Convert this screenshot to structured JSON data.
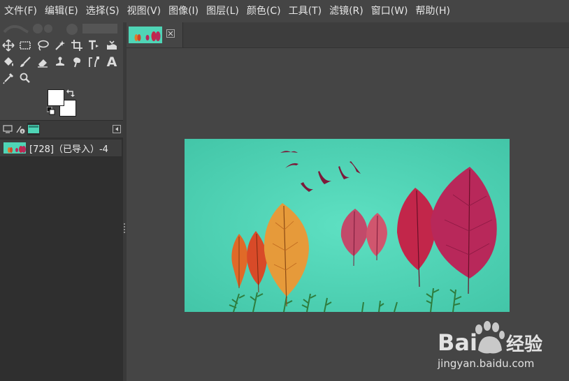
{
  "menubar": {
    "items": [
      "文件(F)",
      "编辑(E)",
      "选择(S)",
      "视图(V)",
      "图像(I)",
      "图层(L)",
      "颜色(C)",
      "工具(T)",
      "滤镜(R)",
      "窗口(W)",
      "帮助(H)"
    ]
  },
  "toolbox": {
    "tools": [
      "move-tool",
      "rect-select-tool",
      "lasso-select-tool",
      "fuzzy-select-tool",
      "crop-tool",
      "unified-transform-tool",
      "warp-transform-tool",
      "bucket-fill-tool",
      "paintbrush-tool",
      "eraser-tool",
      "clone-tool",
      "smudge-tool",
      "paths-tool",
      "text-tool",
      "color-picker-tool",
      "zoom-tool"
    ],
    "text_tool_glyph": "A",
    "foreground_color": "#ffffff",
    "background_color": "#ffffff"
  },
  "layers": {
    "rows": [
      {
        "name": "[728]（已导入）-4"
      }
    ]
  },
  "image_tab": {
    "close_icon": "close-icon"
  },
  "canvas": {
    "background_color": "#4fd5b6",
    "description_colors": {
      "teal": "#4fd5b6",
      "orange_leaf": "#e07a2a",
      "red_leaf": "#c2264a",
      "magenta_leaf": "#b8285a",
      "grass": "#2e7d3e"
    }
  },
  "watermark": {
    "brand": "Bai",
    "brand_suffix": "经验",
    "url": "jingyan.baidu.com"
  }
}
